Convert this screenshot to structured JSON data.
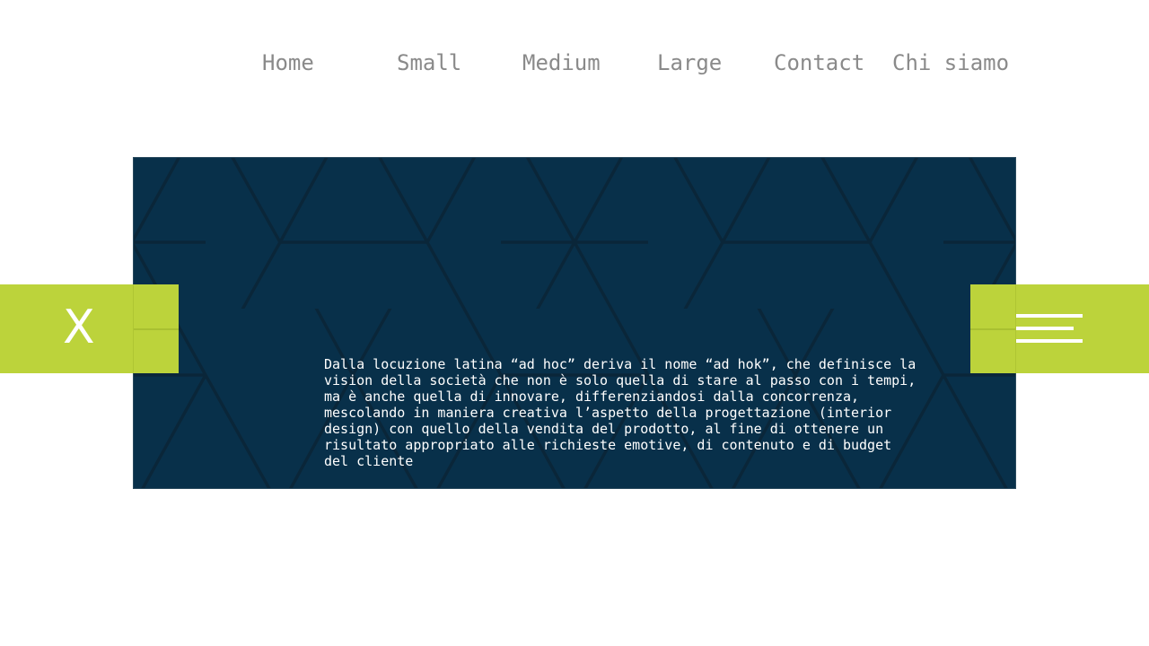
{
  "nav": {
    "items": [
      {
        "label": "Home"
      },
      {
        "label": "Small"
      },
      {
        "label": "Medium"
      },
      {
        "label": "Large"
      },
      {
        "label": "Contact"
      },
      {
        "label": "Chi siamo"
      }
    ]
  },
  "panel": {
    "text": "Dalla locuzione latina “ad hoc” deriva il nome “ad hok”, che definisce la\nvision della società che non è solo quella di stare al passo con i tempi,\nma è anche quella di innovare, differenziandosi dalla concorrenza,\nmescolando in maniera creativa l’aspetto della progettazione (interior\ndesign) con quello della vendita del prodotto, al fine di ottenere un\nrisultato appropriato alle richieste emotive, di contenuto e di budget\ndel cliente",
    "background_color": "#08304a",
    "pattern": "hexagon-pattern"
  },
  "left_control": {
    "label": "X",
    "icon": "close-icon"
  },
  "right_control": {
    "icon": "hamburger-menu-icon"
  },
  "colors": {
    "accent": "#bcd33b",
    "nav_text": "#8a8a8a",
    "panel_text": "#ffffff"
  }
}
